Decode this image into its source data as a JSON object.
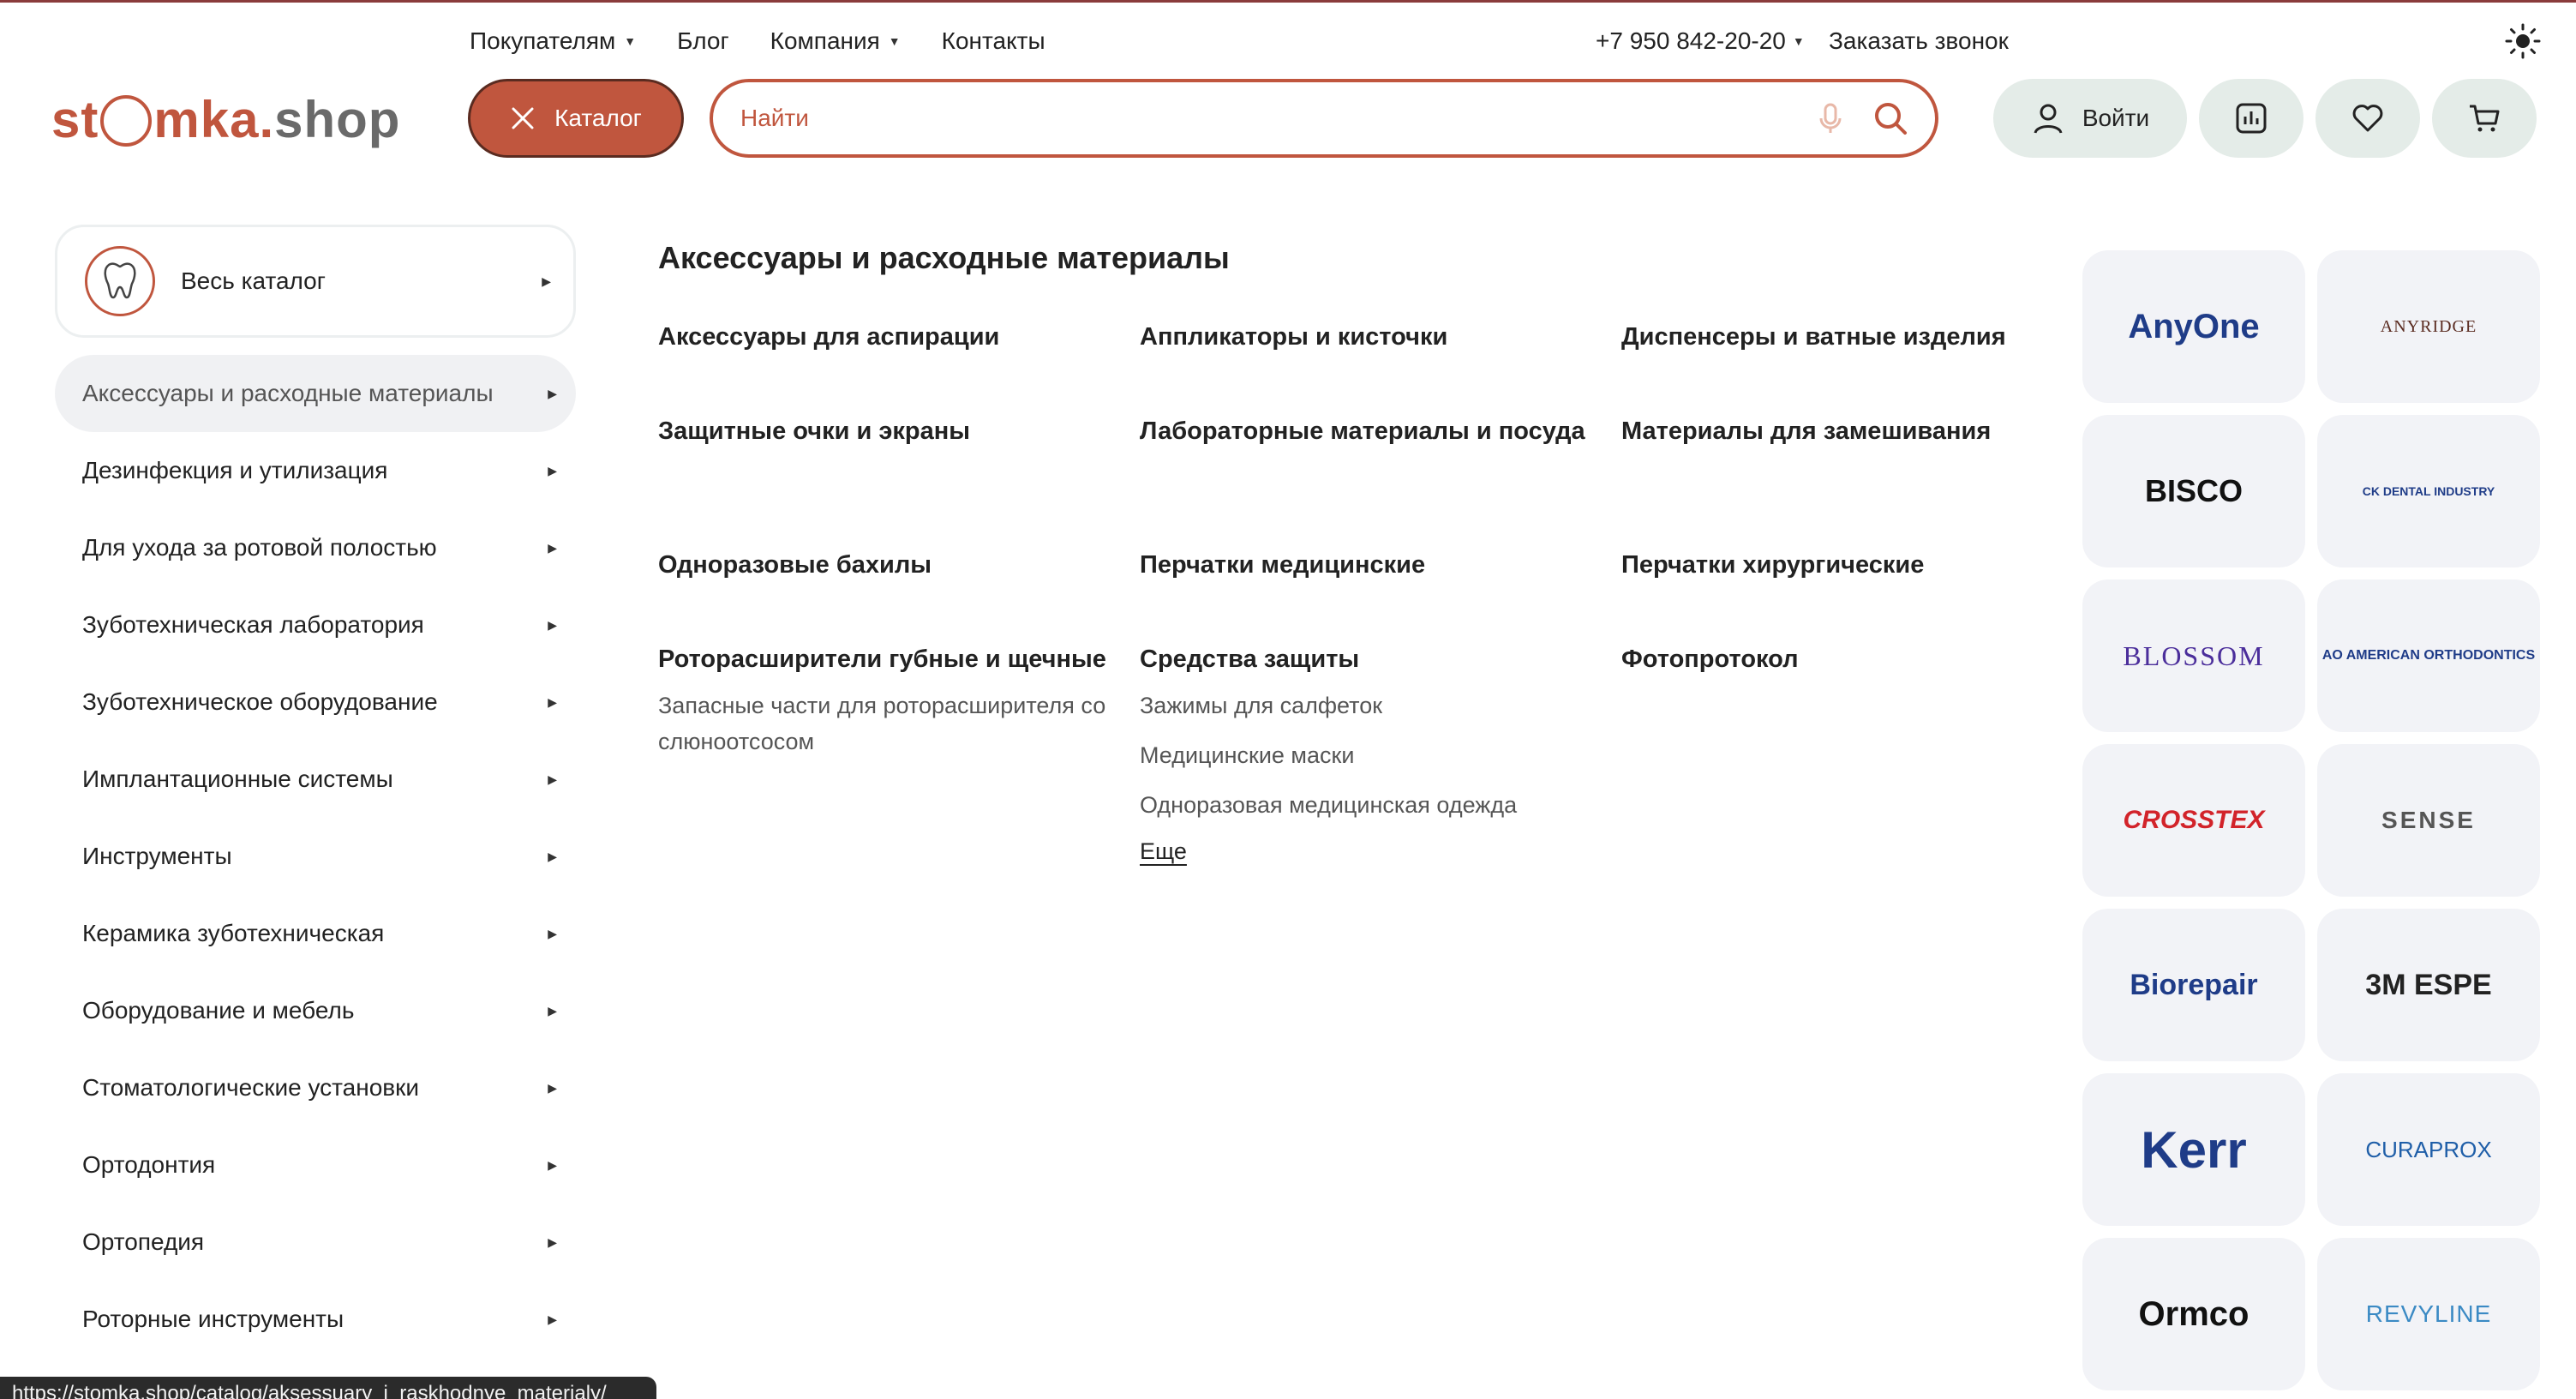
{
  "topnav": {
    "items": [
      {
        "label": "Покупателям",
        "has_dropdown": true
      },
      {
        "label": "Блог",
        "has_dropdown": false
      },
      {
        "label": "Компания",
        "has_dropdown": true
      },
      {
        "label": "Контакты",
        "has_dropdown": false
      }
    ],
    "phone": "+7 950 842-20-20",
    "callback": "Заказать звонок"
  },
  "header": {
    "logo_part1": "st",
    "logo_part2": "mka.",
    "logo_part3": "shop",
    "catalog_button": "Каталог",
    "search_placeholder": "Найти",
    "login_label": "Войти"
  },
  "sidebar": {
    "all_catalog": "Весь каталог",
    "items": [
      {
        "label": "Аксессуары и расходные материалы",
        "active": true
      },
      {
        "label": "Дезинфекция и утилизация"
      },
      {
        "label": "Для ухода за ротовой полостью"
      },
      {
        "label": "Зуботехническая лаборатория"
      },
      {
        "label": "Зуботехническое оборудование"
      },
      {
        "label": "Имплантационные системы"
      },
      {
        "label": "Инструменты"
      },
      {
        "label": "Керамика зуботехническая"
      },
      {
        "label": "Оборудование и мебель"
      },
      {
        "label": "Стоматологические установки"
      },
      {
        "label": "Ортодонтия"
      },
      {
        "label": "Ортопедия"
      },
      {
        "label": "Роторные инструменты"
      }
    ]
  },
  "main": {
    "title": "Аксессуары и расходные материалы",
    "subcategories": [
      {
        "label": "Аксессуары для аспирации"
      },
      {
        "label": "Аппликаторы и кисточки"
      },
      {
        "label": "Диспенсеры и ватные изделия"
      },
      {
        "label": "Защитные очки и экраны"
      },
      {
        "label": "Лабораторные материалы и посуда"
      },
      {
        "label": "Материалы для замешивания"
      },
      {
        "label": "Одноразовые бахилы"
      },
      {
        "label": "Перчатки медицинские"
      },
      {
        "label": "Перчатки хирургические"
      },
      {
        "label": "Роторасширители губные и щечные",
        "children": [
          "Запасные части для роторасширителя со слюноотсосом"
        ]
      },
      {
        "label": "Средства защиты",
        "children": [
          "Зажимы для салфеток",
          "Медицинские маски",
          "Одноразовая медицинская одежда"
        ],
        "more": "Еще"
      },
      {
        "label": "Фотопротокол"
      }
    ]
  },
  "brands": [
    "AnyOne",
    "ANYRIDGE",
    "BISCO",
    "CK DENTAL INDUSTRY",
    "BLOSSOM",
    "AO AMERICAN ORTHODONTICS",
    "CROSSTEX",
    "SENSE",
    "Biorepair",
    "3M ESPE",
    "Kerr",
    "CURAPROX",
    "Ormco",
    "REVYLINE"
  ],
  "statusbar_url": "https://stomka.shop/catalog/aksessuary_i_raskhodnye_materialy/",
  "colors": {
    "accent": "#c0563e",
    "pill_bg": "#e4ece8",
    "active_bg": "#f0f1f3",
    "brand_bg": "#f2f3f7"
  }
}
